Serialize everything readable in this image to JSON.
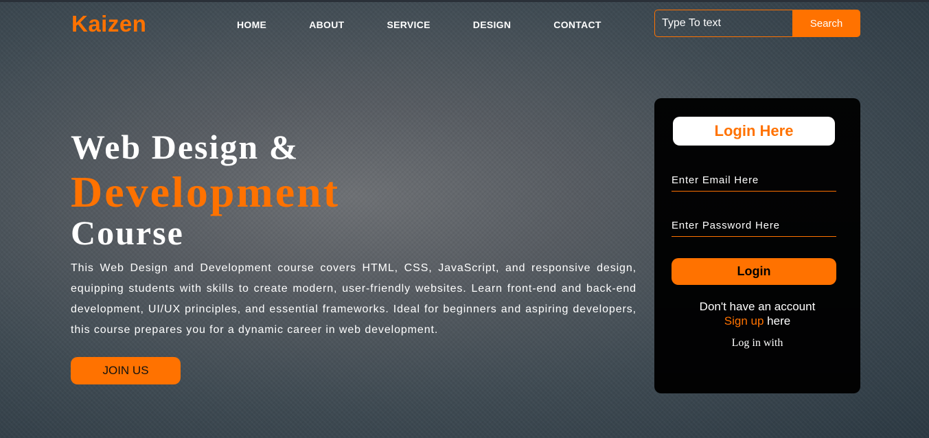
{
  "brand": {
    "logo": "Kaizen",
    "accent_color": "#ff7200"
  },
  "nav": {
    "items": [
      {
        "label": "HOME"
      },
      {
        "label": "ABOUT"
      },
      {
        "label": "SERVICE"
      },
      {
        "label": "DESIGN"
      },
      {
        "label": "CONTACT"
      }
    ]
  },
  "search": {
    "placeholder": "Type To text",
    "button_label": "Search"
  },
  "hero": {
    "line1": "Web Design &",
    "line2": "Development",
    "line3": "Course",
    "description": "This Web Design and Development course covers HTML, CSS, JavaScript, and responsive design, equipping students with skills to create modern, user-friendly websites. Learn front-end and back-end development, UI/UX principles, and essential frameworks. Ideal for beginners and aspiring developers, this course prepares you for a dynamic career in web development.",
    "join_label": "JOIN US"
  },
  "login": {
    "heading": "Login Here",
    "email_placeholder": "Enter Email Here",
    "password_placeholder": "Enter Password Here",
    "button_label": "Login",
    "no_account": "Don't have an account",
    "signup_link": "Sign up",
    "signup_suffix": " here",
    "login_with": "Log in with"
  }
}
